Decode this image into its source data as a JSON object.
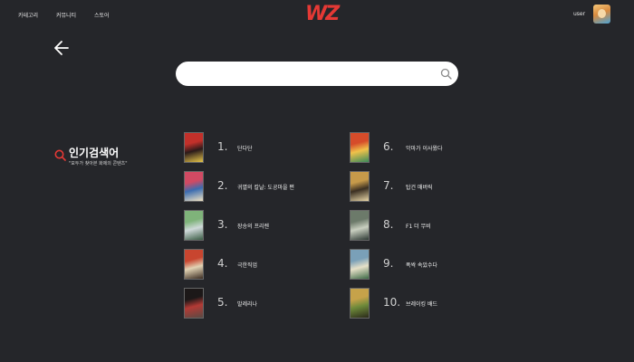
{
  "nav": {
    "links": [
      "카테고리",
      "커뮤니티",
      "스토어"
    ],
    "logo": "WZ",
    "username": "user"
  },
  "search": {
    "placeholder": ""
  },
  "popular": {
    "title": "인기검색어",
    "subtitle": "\"모두가 찾아본 화제의 콘텐츠\"",
    "items": [
      {
        "rank": "1.",
        "title": "단다단",
        "poster": [
          "#c2302a",
          "#2a1a1a",
          "#e6c54a"
        ]
      },
      {
        "rank": "2.",
        "title": "귀멸의 칼날: 도공마을 편",
        "poster": [
          "#d14a63",
          "#3b6cb0",
          "#f0e2c2"
        ]
      },
      {
        "rank": "3.",
        "title": "장송의 프리렌",
        "poster": [
          "#7fb37a",
          "#cfd9d9",
          "#3b5c45"
        ]
      },
      {
        "rank": "4.",
        "title": "극한직업",
        "poster": [
          "#c8452f",
          "#e2d3b4",
          "#3a2b22"
        ]
      },
      {
        "rank": "5.",
        "title": "발레리나",
        "poster": [
          "#1c1818",
          "#b33a35",
          "#5a4a44"
        ]
      },
      {
        "rank": "6.",
        "title": "악마가 이사왔다",
        "poster": [
          "#d64c2a",
          "#f0c24a",
          "#3a8a5a"
        ]
      },
      {
        "rank": "7.",
        "title": "탑건 매버릭",
        "poster": [
          "#c69a4a",
          "#3a2f22",
          "#e8d6a8"
        ]
      },
      {
        "rank": "8.",
        "title": "F1 더 무비",
        "poster": [
          "#6c7a6a",
          "#c9cfc0",
          "#2e3a34"
        ]
      },
      {
        "rank": "9.",
        "title": "폭싹 속았수다",
        "poster": [
          "#7aa0b8",
          "#e6e0c8",
          "#3f6b48"
        ]
      },
      {
        "rank": "10.",
        "title": "브레이킹 배드",
        "poster": [
          "#c6a24a",
          "#6e8a3a",
          "#2a2a1a"
        ]
      }
    ]
  },
  "colors": {
    "background": "#25262a",
    "accent": "#e53935"
  },
  "icons": {
    "back": "arrow-left-icon",
    "search": "search-icon",
    "popular": "search-icon"
  }
}
